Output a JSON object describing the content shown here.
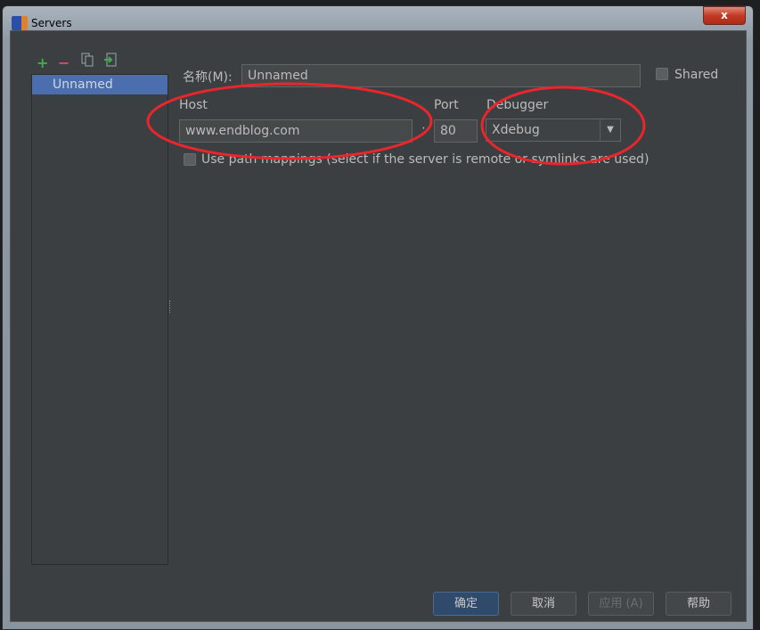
{
  "window": {
    "title": "Servers",
    "close_label": "x"
  },
  "toolbar": {
    "add": "+",
    "remove": "−"
  },
  "servers": {
    "items": [
      {
        "label": "Unnamed",
        "selected": true
      }
    ]
  },
  "form": {
    "name_label": "名称(M):",
    "name_value": "Unnamed",
    "shared_label": "Shared",
    "shared_checked": false,
    "host_label": "Host",
    "host_value": "www.endblog.com",
    "separator": ":",
    "port_label": "Port",
    "port_value": "80",
    "debugger_label": "Debugger",
    "debugger_value": "Xdebug",
    "path_mappings_label": "Use path mappings (select if the server is remote or symlinks are used)",
    "path_mappings_checked": false
  },
  "buttons": {
    "ok": "确定",
    "cancel": "取消",
    "apply": "应用 (A)",
    "help": "帮助"
  },
  "colors": {
    "annotation": "#e8262c",
    "selection": "#4b6eaf",
    "background": "#3c3f41"
  }
}
